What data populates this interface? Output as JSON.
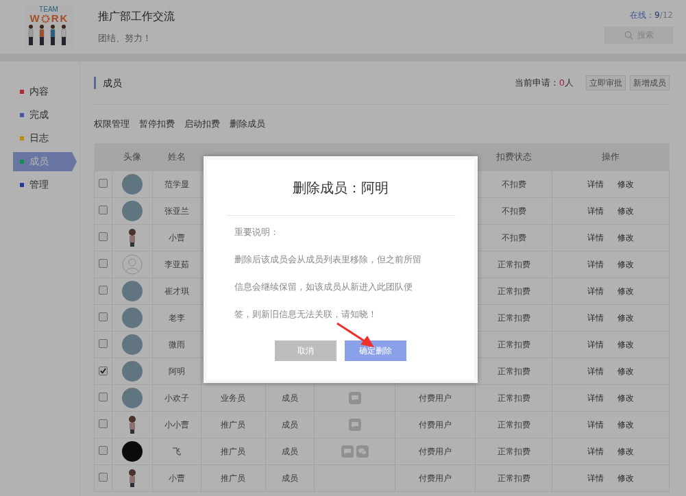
{
  "header": {
    "logo": {
      "top": "TEAM",
      "letters": [
        "W",
        "R",
        "K"
      ]
    },
    "title": "推广部工作交流",
    "subtitle": "团结、努力！",
    "online": {
      "label": "在线：",
      "count": "9",
      "total": "/12"
    },
    "search": {
      "placeholder": "搜索"
    }
  },
  "sidebar": {
    "items": [
      {
        "label": "内容",
        "color": "#b02a36",
        "selected": false
      },
      {
        "label": "完成",
        "color": "#4657a8",
        "selected": false
      },
      {
        "label": "日志",
        "color": "#c08a10",
        "selected": false
      },
      {
        "label": "成员",
        "color": "#109050",
        "selected": true
      },
      {
        "label": "管理",
        "color": "#203c98",
        "selected": false
      }
    ]
  },
  "section": {
    "title": "成员",
    "apply_label": "当前申请：",
    "apply_count": "0",
    "apply_unit": "人",
    "buttons": [
      "立即审批",
      "新增成员"
    ]
  },
  "actions": [
    "权限管理",
    "暂停扣费",
    "启动扣费",
    "删除成员"
  ],
  "table": {
    "columns": [
      "头像",
      "姓名",
      "扣费状态",
      "操作"
    ],
    "rows": [
      {
        "checked": false,
        "avatar": {
          "kind": "photo"
        },
        "name": "范学显",
        "status": "不扣费",
        "actions": [
          "详情",
          "修改"
        ]
      },
      {
        "checked": false,
        "avatar": {
          "kind": "photo"
        },
        "name": "张亚兰",
        "status": "不扣费",
        "actions": [
          "详情",
          "修改"
        ]
      },
      {
        "checked": false,
        "avatar": {
          "kind": "figure"
        },
        "name": "小曹",
        "status": "不扣费",
        "actions": [
          "详情",
          "修改"
        ]
      },
      {
        "checked": false,
        "avatar": {
          "kind": "default"
        },
        "name": "李亚茹",
        "status": "正常扣费",
        "actions": [
          "详情",
          "修改"
        ]
      },
      {
        "checked": false,
        "avatar": {
          "kind": "photo"
        },
        "name": "崔才琪",
        "status": "正常扣费",
        "actions": [
          "详情",
          "修改"
        ]
      },
      {
        "checked": false,
        "avatar": {
          "kind": "photo"
        },
        "name": "老李",
        "status": "正常扣费",
        "actions": [
          "详情",
          "修改"
        ]
      },
      {
        "checked": false,
        "avatar": {
          "kind": "photo"
        },
        "name": "微雨",
        "status": "正常扣费",
        "actions": [
          "详情",
          "修改"
        ]
      },
      {
        "checked": true,
        "avatar": {
          "kind": "photo"
        },
        "name": "阿明",
        "status": "正常扣费",
        "actions": [
          "详情",
          "修改"
        ]
      },
      {
        "checked": false,
        "avatar": {
          "kind": "photo"
        },
        "name": "小欢子",
        "role": "业务员",
        "group": "成员",
        "push": [
          {
            "kind": "sms"
          }
        ],
        "type": "付费用户",
        "status": "正常扣费",
        "actions": [
          "详情",
          "修改"
        ]
      },
      {
        "checked": false,
        "avatar": {
          "kind": "figure"
        },
        "name": "小小曹",
        "role": "推广员",
        "group": "成员",
        "push": [
          {
            "kind": "sms"
          }
        ],
        "type": "付费用户",
        "status": "正常扣费",
        "actions": [
          "详情",
          "修改"
        ]
      },
      {
        "checked": false,
        "avatar": {
          "kind": "dark"
        },
        "name": "飞",
        "role": "推广员",
        "group": "成员",
        "push": [
          {
            "kind": "sms"
          },
          {
            "kind": "wechat"
          }
        ],
        "type": "付费用户",
        "status": "正常扣费",
        "actions": [
          "详情",
          "修改"
        ]
      },
      {
        "checked": false,
        "avatar": {
          "kind": "figure"
        },
        "name": "小曹",
        "role": "推广员",
        "group": "成员",
        "type": "付费用户",
        "status": "正常扣费",
        "actions": [
          "详情",
          "修改"
        ]
      }
    ]
  },
  "dialog": {
    "title": "删除成员：阿明",
    "note_title": "重要说明：",
    "lines": [
      "删除后该成员会从成员列表里移除，但之前所留",
      "信息会继续保留，如该成员从新进入此团队便",
      "签，则新旧信息无法关联，请知晓！"
    ],
    "cancel": "取消",
    "confirm": "确定删除"
  }
}
